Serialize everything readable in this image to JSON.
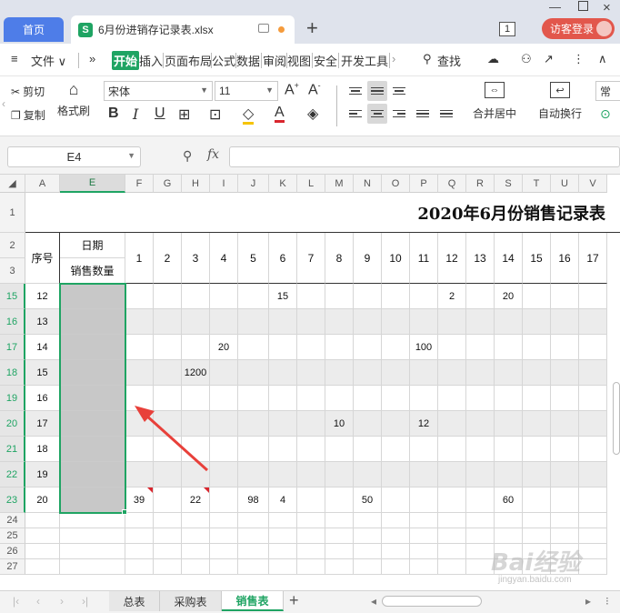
{
  "titlebar": {
    "home_tab": "首页",
    "file_tab": "6月份进销存记录表.xlsx",
    "file_icon": "S",
    "new_tab": "+",
    "window_count": "1",
    "visitor_login": "访客登录"
  },
  "menu": {
    "file": "文件",
    "more": "»",
    "items": [
      "开始",
      "插入",
      "页面布局",
      "公式",
      "数据",
      "审阅",
      "视图",
      "安全",
      "开发工具"
    ],
    "search": "查找"
  },
  "toolbar": {
    "cut": "剪切",
    "copy": "复制",
    "format_painter": "格式刷",
    "font_name": "宋体",
    "font_size": "11",
    "merge_center": "合并居中",
    "wrap_text": "自动换行",
    "normal": "常"
  },
  "formula_bar": {
    "cell_ref": "E4",
    "fx": "fx"
  },
  "sheet": {
    "col_headers": [
      "A",
      "E",
      "F",
      "G",
      "H",
      "I",
      "J",
      "K",
      "L",
      "M",
      "N",
      "O",
      "P",
      "Q",
      "R",
      "S",
      "T",
      "U",
      "V"
    ],
    "row_headers": [
      "1",
      "2",
      "3",
      "15",
      "16",
      "17",
      "18",
      "19",
      "20",
      "21",
      "22",
      "23",
      "24",
      "25",
      "26",
      "27"
    ],
    "title": "2020年6月份销售记录表",
    "header_seq": "序号",
    "header_date": "日期",
    "header_qty": "销售数量",
    "days": [
      "1",
      "2",
      "3",
      "4",
      "5",
      "6",
      "7",
      "8",
      "9",
      "10",
      "11",
      "12",
      "13",
      "14",
      "15",
      "16",
      "17"
    ],
    "rows": [
      {
        "seq": "12",
        "vals": [
          "",
          "",
          "",
          "",
          "",
          "15",
          "",
          "",
          "",
          "",
          "",
          "2",
          "",
          "20",
          "",
          "",
          ""
        ]
      },
      {
        "seq": "13",
        "vals": [
          "",
          "",
          "",
          "",
          "",
          "",
          "",
          "",
          "",
          "",
          "",
          "",
          "",
          "",
          "",
          "",
          ""
        ]
      },
      {
        "seq": "14",
        "vals": [
          "",
          "",
          "",
          "20",
          "",
          "",
          "",
          "",
          "",
          "",
          "100",
          "",
          "",
          "",
          "",
          "",
          ""
        ]
      },
      {
        "seq": "15",
        "vals": [
          "",
          "",
          "1200",
          "",
          "",
          "",
          "",
          "",
          "",
          "",
          "",
          "",
          "",
          "",
          "",
          "",
          ""
        ]
      },
      {
        "seq": "16",
        "vals": [
          "",
          "",
          "",
          "",
          "",
          "",
          "",
          "",
          "",
          "",
          "",
          "",
          "",
          "",
          "",
          "",
          ""
        ]
      },
      {
        "seq": "17",
        "vals": [
          "",
          "",
          "",
          "",
          "",
          "",
          "",
          "10",
          "",
          "",
          "12",
          "",
          "",
          "",
          "",
          "",
          ""
        ]
      },
      {
        "seq": "18",
        "vals": [
          "",
          "",
          "",
          "",
          "",
          "",
          "",
          "",
          "",
          "",
          "",
          "",
          "",
          "",
          "",
          "",
          ""
        ]
      },
      {
        "seq": "19",
        "vals": [
          "",
          "",
          "",
          "",
          "",
          "",
          "",
          "",
          "",
          "",
          "",
          "",
          "",
          "",
          "",
          "",
          ""
        ]
      },
      {
        "seq": "20",
        "vals": [
          "39",
          "",
          "22",
          "",
          "98",
          "4",
          "",
          "",
          "50",
          "",
          "",
          "",
          "",
          "60",
          "",
          "",
          ""
        ]
      }
    ]
  },
  "sheet_tabs": [
    "总表",
    "采购表",
    "销售表"
  ],
  "active_sheet": "销售表",
  "watermark": {
    "main": "Bai经验",
    "sub": "jingyan.baidu.com"
  },
  "colors": {
    "accent": "#1fa463",
    "home_tab": "#4e7de8",
    "visitor": "#e2574c",
    "arrow": "#e8403a"
  }
}
